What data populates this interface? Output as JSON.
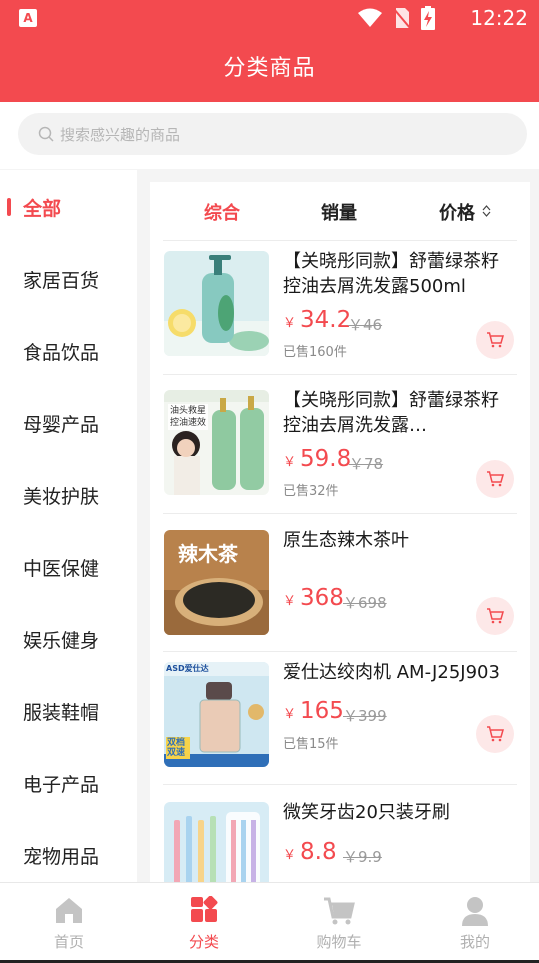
{
  "status": {
    "time": "12:22",
    "app_icon": "A"
  },
  "header": {
    "title": "分类商品"
  },
  "search": {
    "placeholder": "搜索感兴趣的商品"
  },
  "sidebar": {
    "items": [
      {
        "label": "全部",
        "active": true
      },
      {
        "label": "家居百货"
      },
      {
        "label": "食品饮品"
      },
      {
        "label": "母婴产品"
      },
      {
        "label": "美妆护肤"
      },
      {
        "label": "中医保健"
      },
      {
        "label": "娱乐健身"
      },
      {
        "label": "服装鞋帽"
      },
      {
        "label": "电子产品"
      },
      {
        "label": "宠物用品"
      }
    ]
  },
  "sort": {
    "comprehensive": "综合",
    "sales": "销量",
    "price": "价格"
  },
  "products": [
    {
      "title": "【关晓彤同款】舒蕾绿茶籽控油去屑洗发露500ml",
      "currency": "￥",
      "price": "34.2",
      "orig": "￥46",
      "sold": "已售160件"
    },
    {
      "title": "【关晓彤同款】舒蕾绿茶籽控油去屑洗发露…",
      "currency": "￥",
      "price": "59.8",
      "orig": "￥78",
      "sold": "已售32件"
    },
    {
      "title": "原生态辣木茶叶",
      "currency": "￥",
      "price": "368",
      "orig": "￥698",
      "sold": ""
    },
    {
      "title": "爱仕达绞肉机 AM-J25J903",
      "currency": "￥",
      "price": "165",
      "orig": "￥399",
      "sold": "已售15件"
    },
    {
      "title": "微笑牙齿20只装牙刷",
      "currency": "￥",
      "price": "8.8",
      "orig": "￥9.9",
      "sold": ""
    }
  ],
  "thumb_text": {
    "p2_badge": "油头救星",
    "p2_badge2": "控油速效",
    "p3_title": "辣木茶",
    "p4_brand": "ASD爱仕达",
    "p4_tag": "双档双速"
  },
  "tabs": [
    {
      "label": "首页",
      "icon": "home-icon"
    },
    {
      "label": "分类",
      "icon": "category-icon",
      "active": true
    },
    {
      "label": "购物车",
      "icon": "cart-icon"
    },
    {
      "label": "我的",
      "icon": "user-icon"
    }
  ],
  "colors": {
    "accent": "#f34a4f",
    "inactive": "#b0b0b0"
  }
}
